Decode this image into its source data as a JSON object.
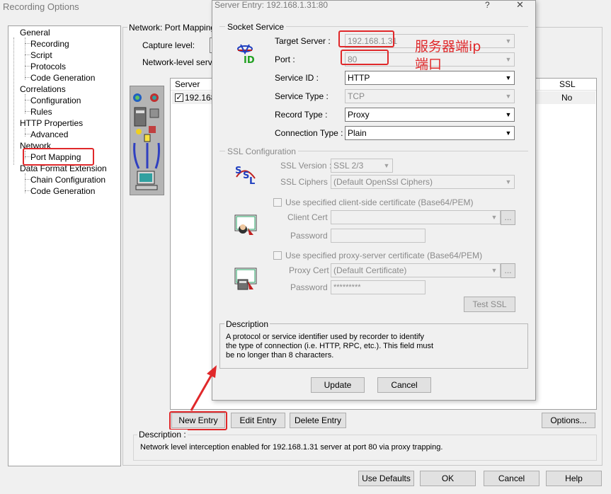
{
  "main_window": {
    "title": "Recording Options",
    "tree": {
      "items": [
        {
          "label": "General"
        },
        {
          "label": "Recording"
        },
        {
          "label": "Script"
        },
        {
          "label": "Protocols"
        },
        {
          "label": "Code Generation"
        },
        {
          "label": "Correlations"
        },
        {
          "label": "Configuration"
        },
        {
          "label": "Rules"
        },
        {
          "label": "HTTP Properties"
        },
        {
          "label": "Advanced"
        },
        {
          "label": "Network"
        },
        {
          "label": "Port Mapping"
        },
        {
          "label": "Data Format Extension"
        },
        {
          "label": "Chain Configuration"
        },
        {
          "label": "Code Generation"
        }
      ]
    },
    "panel": {
      "title": "Network: Port Mapping",
      "capture_level_label": "Capture level:",
      "network_level_label": "Network-level server",
      "list": {
        "headers": {
          "server": "Server",
          "ssl": "SSL"
        },
        "rows": [
          {
            "checked": true,
            "server": "192.168",
            "ssl": "No"
          }
        ]
      },
      "buttons": {
        "new_entry": "New Entry",
        "edit_entry": "Edit Entry",
        "delete_entry": "Delete Entry",
        "options": "Options..."
      },
      "description_label": "Description :",
      "description_text": "Network level interception enabled for 192.168.1.31 server at port 80 via proxy trapping."
    },
    "bottom_buttons": {
      "use_defaults": "Use Defaults",
      "ok": "OK",
      "cancel": "Cancel",
      "help": "Help"
    }
  },
  "dialog": {
    "title": "Server Entry: 192.168.1.31:80",
    "help_glyph": "?",
    "close_glyph": "✕",
    "socket_service": {
      "legend": "Socket Service",
      "target_server_label": "Target Server :",
      "target_server_value": "192.168.1.31",
      "port_label": "Port :",
      "port_value": "80",
      "service_id_label": "Service ID :",
      "service_id_value": "HTTP",
      "service_type_label": "Service Type :",
      "service_type_value": "TCP",
      "record_type_label": "Record Type :",
      "record_type_value": "Proxy",
      "connection_type_label": "Connection Type :",
      "connection_type_value": "Plain"
    },
    "ssl_config": {
      "legend": "SSL Configuration",
      "ssl_version_label": "SSL Version :",
      "ssl_version_value": "SSL 2/3",
      "ssl_ciphers_label": "SSL Ciphers :",
      "ssl_ciphers_value": "(Default OpenSsl Ciphers)",
      "client_cert_checkbox_label": "Use specified client-side certificate (Base64/PEM)",
      "client_cert_label": "Client Cert :",
      "client_cert_value": "",
      "client_password_label": "Password :",
      "client_password_value": "",
      "proxy_cert_checkbox_label": "Use specified proxy-server certificate (Base64/PEM)",
      "proxy_cert_label": "Proxy Cert :",
      "proxy_cert_value": "(Default Certificate)",
      "proxy_password_label": "Password :",
      "proxy_password_value": "*********",
      "browse_label": "...",
      "test_ssl": "Test SSL"
    },
    "description": {
      "legend": "Description",
      "lines": [
        "A protocol or service identifier used by recorder to identify",
        "the type of connection (i.e. HTTP, RPC, etc.).  This field must",
        "be no longer than 8 characters."
      ]
    },
    "buttons": {
      "update": "Update",
      "cancel": "Cancel"
    }
  },
  "annotations": {
    "server_ip": "服务器端ip",
    "port": "端口",
    "color": "#e0282a"
  }
}
